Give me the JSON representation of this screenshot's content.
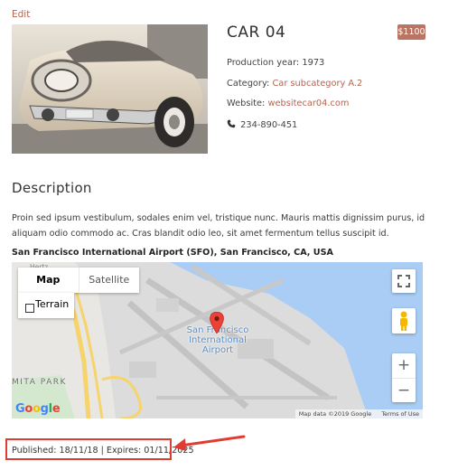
{
  "edit_label": "Edit",
  "listing": {
    "title": "CAR 04",
    "price": "$1100",
    "production_label": "Production year:",
    "production_year": "1973",
    "category_label": "Category:",
    "category_value": "Car subcategory A.2",
    "website_label": "Website:",
    "website_value": "websitecar04.com",
    "phone": "234-890-451"
  },
  "description": {
    "heading": "Description",
    "text": "Proin sed ipsum vestibulum, sodales enim vel, tristique nunc. Mauris mattis dignissim purus, id aliquam odio commodo ac. Cras blandit odio leo, sit amet fermentum tellus suscipit id."
  },
  "location": {
    "address": "San Francisco International Airport (SFO), San Francisco, CA, USA"
  },
  "map": {
    "tab_map": "Map",
    "tab_satellite": "Satellite",
    "terrain_label": "Terrain",
    "place_label_1": "San Francisco",
    "place_label_2": "International",
    "place_label_3": "Airport",
    "park_label": "MITA PARK",
    "hertz_label": "Hertz",
    "google_logo": "Google",
    "map_data": "Map data ©2019 Google",
    "terms": "Terms of Use",
    "zoom_in": "+",
    "zoom_out": "−"
  },
  "meta": {
    "published_line": "Published: 18/11/18 | Expires: 01/11/2025"
  },
  "colors": {
    "accent_link": "#b5644f",
    "price_badge": "#b87564",
    "water": "#a9cdf5",
    "annotation_red": "#e03c31"
  }
}
